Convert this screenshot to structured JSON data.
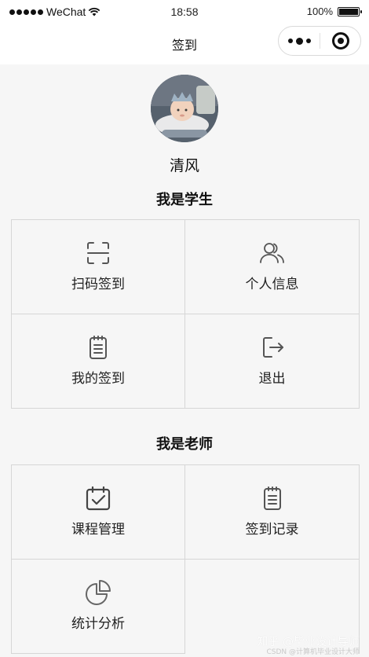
{
  "status_bar": {
    "carrier": "WeChat",
    "time": "18:58",
    "battery": "100%",
    "battery_level": 1.0
  },
  "nav": {
    "title": "签到"
  },
  "profile": {
    "name": "清风"
  },
  "student_section": {
    "title": "我是学生",
    "items": [
      {
        "label": "扫码签到",
        "icon": "scan-icon"
      },
      {
        "label": "个人信息",
        "icon": "users-icon"
      },
      {
        "label": "我的签到",
        "icon": "clipboard-icon"
      },
      {
        "label": "退出",
        "icon": "logout-icon"
      }
    ]
  },
  "teacher_section": {
    "title": "我是老师",
    "items": [
      {
        "label": "课程管理",
        "icon": "calendar-check-icon"
      },
      {
        "label": "签到记录",
        "icon": "clipboard-icon"
      },
      {
        "label": "统计分析",
        "icon": "pie-chart-icon"
      }
    ]
  },
  "watermark": {
    "text": "知乎 @毕业设计导师",
    "sub": "CSDN @计算机毕业设计大师"
  },
  "colors": {
    "background": "#f6f6f6",
    "grid_line": "#d6d6d6",
    "text": "#222222",
    "icon_stroke": "#555555"
  }
}
